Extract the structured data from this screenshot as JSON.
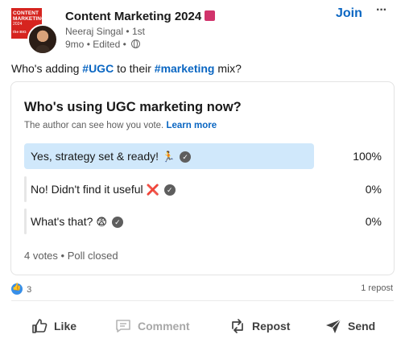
{
  "group": {
    "title": "Content Marketing 2024",
    "logo_line1": "CONTENT",
    "logo_line2": "MARKETING",
    "logo_year": "2024",
    "logo_mini": "the BIG"
  },
  "author": {
    "name": "Neeraj Singal",
    "degree": "1st"
  },
  "meta": {
    "age": "9mo",
    "edited": "Edited"
  },
  "header_actions": {
    "join_label": "Join",
    "more_label": "···"
  },
  "post": {
    "prefix": "Who's adding ",
    "tag1": "#UGC",
    "middle": " to their ",
    "tag2": "#marketing",
    "suffix": " mix?"
  },
  "poll": {
    "question": "Who's using UGC marketing now?",
    "note": "The author can see how you vote.",
    "learn_more": "Learn more",
    "options": [
      {
        "label": "Yes, strategy set & ready!",
        "emoji": "🏃",
        "percent_label": "100%",
        "fraction": 1.0
      },
      {
        "label": "No! Didn't find it useful",
        "emoji": "❌",
        "percent_label": "0%",
        "fraction": 0.0
      },
      {
        "label": "What's that?",
        "emoji": "😨",
        "percent_label": "0%",
        "fraction": 0.0
      }
    ],
    "votes": "4 votes",
    "status": "Poll closed"
  },
  "social": {
    "reaction_count": "3",
    "reposts": "1 repost"
  },
  "actions": {
    "like": "Like",
    "comment": "Comment",
    "repost": "Repost",
    "send": "Send"
  },
  "colors": {
    "brand": "#0a66c2",
    "poll_fill": "#d0e8fb",
    "logo_red": "#d6241f"
  }
}
